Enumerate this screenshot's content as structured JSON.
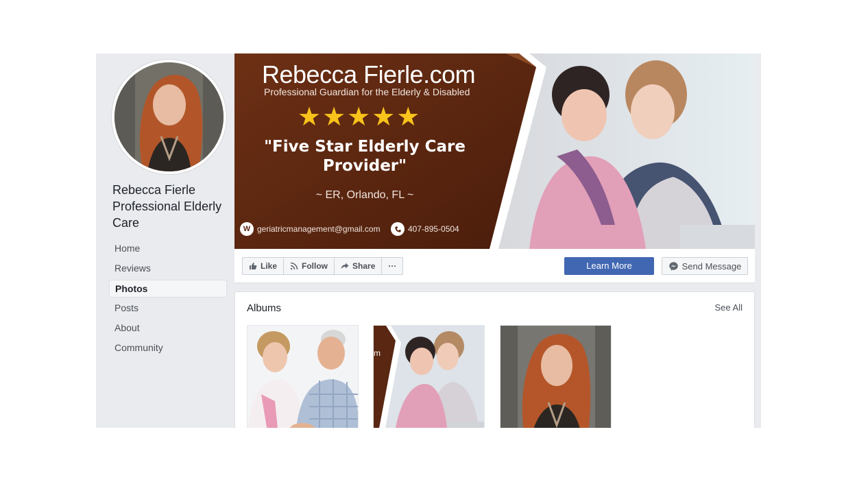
{
  "page": {
    "name_line1": "Rebecca Fierle",
    "name_line2": "Professional Elderly",
    "name_line3": "Care"
  },
  "sidebar": {
    "items": [
      {
        "label": "Home"
      },
      {
        "label": "Reviews"
      },
      {
        "label": "Photos",
        "active": true
      },
      {
        "label": "Posts"
      },
      {
        "label": "About"
      },
      {
        "label": "Community"
      }
    ]
  },
  "cover": {
    "title": "Rebecca Fierle.com",
    "subtitle": "Professional Guardian for the Elderly & Disabled",
    "stars": "★★★★★",
    "quote": "\"Five Star Elderly Care Provider\"",
    "location": "~ ER, Orlando, FL ~",
    "email_icon": "W",
    "email": "geriatricmanagement@gmail.com",
    "phone": "407-895-0504"
  },
  "actions": {
    "like": "Like",
    "follow": "Follow",
    "share": "Share",
    "more": "···",
    "learn_more": "Learn More",
    "send_message": "Send Message"
  },
  "albums": {
    "title": "Albums",
    "see_all": "See All"
  },
  "colors": {
    "primary": "#4267b2",
    "cover_brown": "#5a2712",
    "star": "#f8c31a"
  }
}
